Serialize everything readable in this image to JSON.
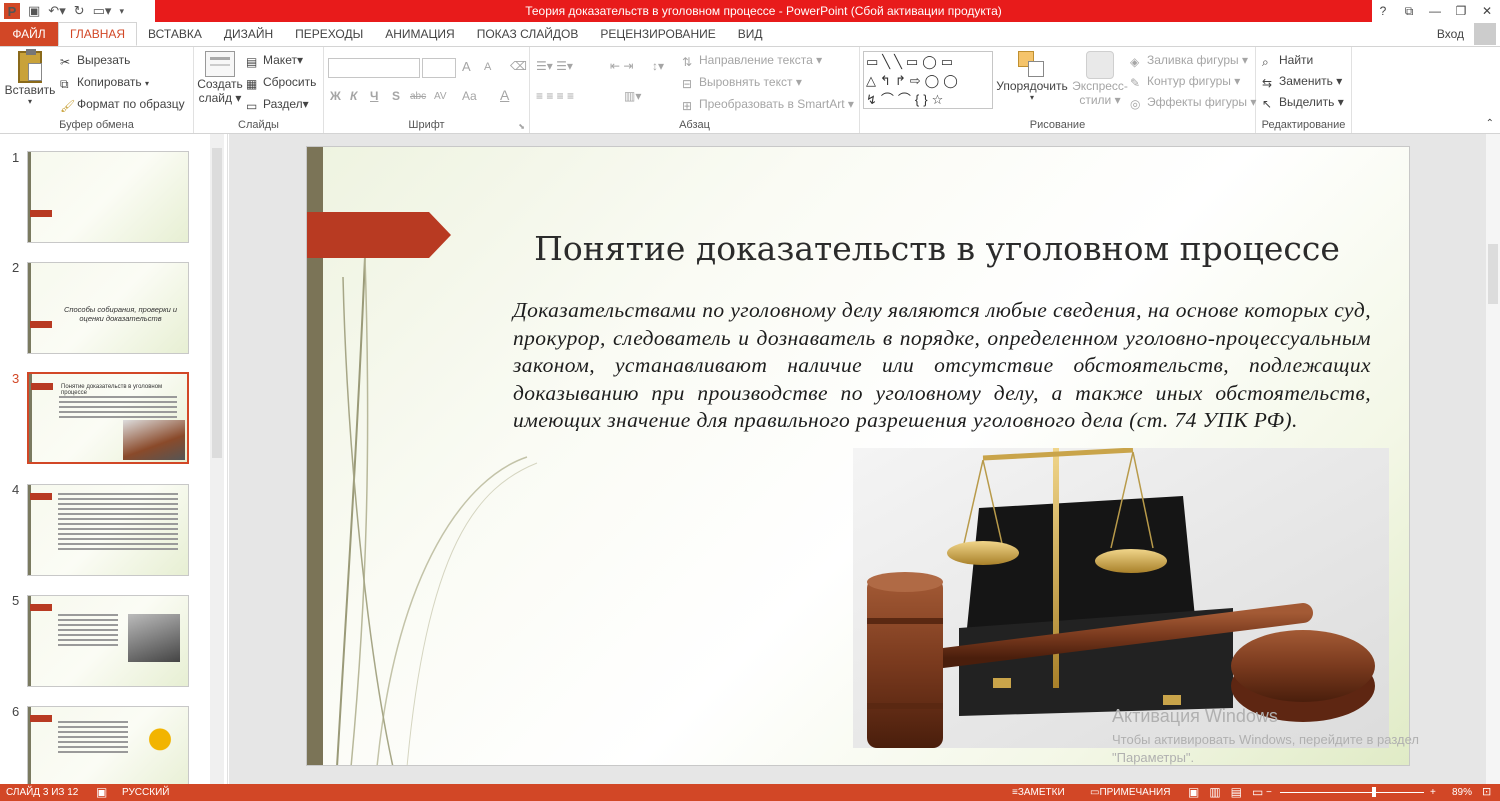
{
  "window": {
    "title": "Теория доказательств в уголовном процессе -  PowerPoint (Сбой активации продукта)",
    "help": "?",
    "signin": "Вход"
  },
  "tabs": [
    "ФАЙЛ",
    "ГЛАВНАЯ",
    "ВСТАВКА",
    "ДИЗАЙН",
    "ПЕРЕХОДЫ",
    "АНИМАЦИЯ",
    "ПОКАЗ СЛАЙДОВ",
    "РЕЦЕНЗИРОВАНИЕ",
    "ВИД"
  ],
  "ribbon": {
    "clipboard": {
      "label": "Буфер обмена",
      "paste": "Вставить",
      "cut": "Вырезать",
      "copy": "Копировать",
      "format_painter": "Формат по образцу"
    },
    "slides": {
      "label": "Слайды",
      "new_slide_1": "Создать",
      "new_slide_2": "слайд",
      "layout": "Макет",
      "reset": "Сбросить",
      "section": "Раздел"
    },
    "font": {
      "label": "Шрифт",
      "bold": "Ж",
      "italic": "К",
      "underline": "Ч",
      "shadow": "S",
      "strike": "abc",
      "spacing": "AV",
      "case": "Aa",
      "color": "A",
      "grow": "A",
      "shrink": "A"
    },
    "paragraph": {
      "label": "Абзац",
      "text_direction": "Направление текста",
      "align_text": "Выровнять текст",
      "smartart": "Преобразовать в SmartArt"
    },
    "drawing": {
      "label": "Рисование",
      "arrange": "Упорядочить",
      "quick_styles_1": "Экспресс-",
      "quick_styles_2": "стили",
      "shape_fill": "Заливка фигуры",
      "shape_outline": "Контур фигуры",
      "shape_effects": "Эффекты фигуры"
    },
    "editing": {
      "label": "Редактирование",
      "find": "Найти",
      "replace": "Заменить",
      "select": "Выделить"
    }
  },
  "slides_pane": {
    "numbers": [
      "1",
      "2",
      "3",
      "4",
      "5",
      "6"
    ],
    "slide2_text": "Способы собирания, проверки и оценки доказательств",
    "slide3_title": "Понятие доказательств в уголовном процессе"
  },
  "slide": {
    "title": "Понятие доказательств в уголовном процессе",
    "body": "Доказательствами по уголовному делу являются любые сведения, на основе которых суд, прокурор, следователь и дознаватель в порядке, определенном уголовно-процессуальным законом, устанавливают наличие или отсутствие обстоятельств, подлежащих доказыванию при производстве по уголовному делу, а также иных обстоятельств, имеющих значение для правильного разрешения уголовного дела (ст. 74 УПК РФ).",
    "accent_color": "#b83a22",
    "bar_color": "#7b7457"
  },
  "watermark": {
    "line1": "Активация Windows",
    "line2": "Чтобы активировать Windows, перейдите в раздел",
    "line3": "\"Параметры\"."
  },
  "status": {
    "slide_info": "СЛАЙД 3 ИЗ 12",
    "language": "РУССКИЙ",
    "notes": "ЗАМЕТКИ",
    "comments": "ПРИМЕЧАНИЯ",
    "zoom": "89%"
  },
  "colors": {
    "brand": "#d24726",
    "title_bar": "#e81b1b"
  }
}
